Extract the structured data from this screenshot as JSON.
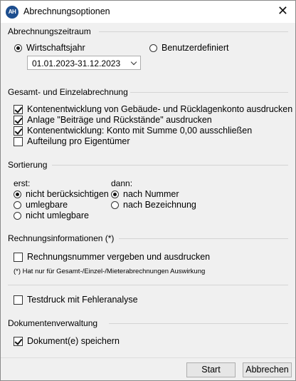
{
  "window": {
    "app_icon_text": "AH",
    "title": "Abrechnungsoptionen"
  },
  "zeitraum": {
    "label": "Abrechnungszeitraum",
    "option_wirtschaftsjahr": "Wirtschaftsjahr",
    "option_benutzerdefiniert": "Benutzerdefiniert",
    "selected": "Wirtschaftsjahr",
    "period_value": "01.01.2023-31.12.2023"
  },
  "gesamt": {
    "label": "Gesamt- und Einzelabrechnung",
    "items": [
      {
        "label": "Kontenentwicklung von Gebäude- und Rücklagenkonto ausdrucken",
        "checked": true
      },
      {
        "label": "Anlage \"Beiträge und Rückstände\" ausdrucken",
        "checked": true
      },
      {
        "label": "Kontenentwicklung: Konto mit Summe 0,00 ausschließen",
        "checked": true
      },
      {
        "label": "Aufteilung pro Eigentümer",
        "checked": false
      }
    ]
  },
  "sortierung": {
    "label": "Sortierung",
    "erst_label": "erst:",
    "erst_options": [
      "nicht berücksichtigen",
      "umlegbare",
      "nicht umlegbare"
    ],
    "erst_selected": 0,
    "dann_label": "dann:",
    "dann_options": [
      "nach Nummer",
      "nach Bezeichnung"
    ],
    "dann_selected": 0
  },
  "rechnung": {
    "label": "Rechnungsinformationen (*)",
    "checkbox_label": "Rechnungsnummer vergeben und ausdrucken",
    "checked": false,
    "note": "(*) Hat nur für Gesamt-/Einzel-/Mieterabrechnungen Auswirkung"
  },
  "testdruck": {
    "checkbox_label": "Testdruck mit Fehleranalyse",
    "checked": false
  },
  "dokument": {
    "label": "Dokumentenverwaltung",
    "checkbox_label": "Dokument(e) speichern",
    "checked": true
  },
  "buttons": {
    "start": "Start",
    "cancel": "Abbrechen"
  }
}
